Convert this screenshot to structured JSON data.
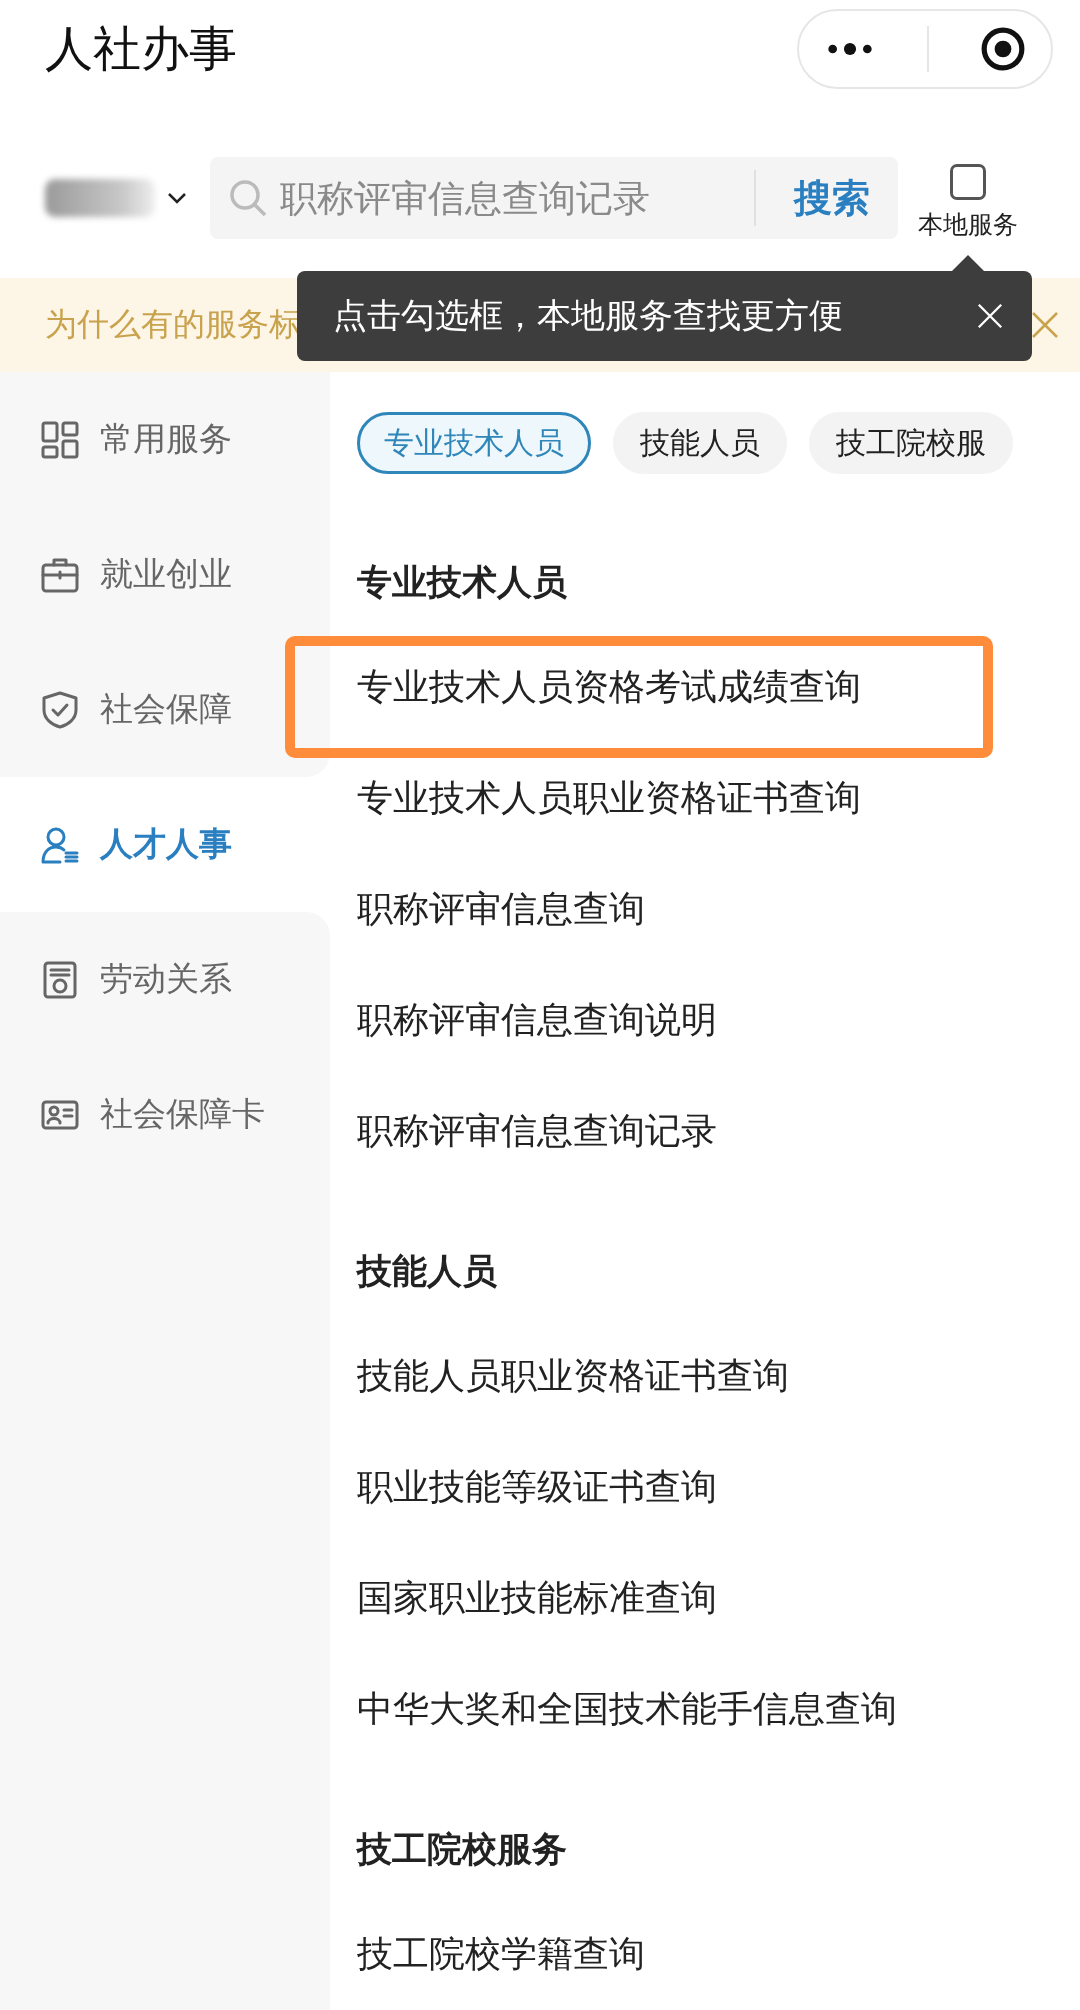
{
  "header": {
    "title": "人社办事"
  },
  "search": {
    "placeholder": "职称评审信息查询记录",
    "button": "搜索"
  },
  "local_service": {
    "label": "本地服务",
    "checked": false
  },
  "notice": {
    "text": "为什么有的服务标"
  },
  "tooltip": {
    "text": "点击勾选框，本地服务查找更方便"
  },
  "sidebar": {
    "items": [
      {
        "label": "常用服务",
        "selected": false
      },
      {
        "label": "就业创业",
        "selected": false
      },
      {
        "label": "社会保障",
        "selected": false
      },
      {
        "label": "人才人事",
        "selected": true
      },
      {
        "label": "劳动关系",
        "selected": false
      },
      {
        "label": "社会保障卡",
        "selected": false
      }
    ]
  },
  "chips": [
    {
      "label": "专业技术人员",
      "selected": true
    },
    {
      "label": "技能人员",
      "selected": false
    },
    {
      "label": "技工院校服",
      "selected": false
    }
  ],
  "sections": [
    {
      "title": "专业技术人员",
      "items": [
        {
          "label": "专业技术人员资格考试成绩查询",
          "highlighted": true
        },
        {
          "label": "专业技术人员职业资格证书查询",
          "highlighted": false
        },
        {
          "label": "职称评审信息查询",
          "highlighted": false
        },
        {
          "label": "职称评审信息查询说明",
          "highlighted": false
        },
        {
          "label": "职称评审信息查询记录",
          "highlighted": false
        }
      ]
    },
    {
      "title": "技能人员",
      "items": [
        {
          "label": "技能人员职业资格证书查询",
          "highlighted": false
        },
        {
          "label": "职业技能等级证书查询",
          "highlighted": false
        },
        {
          "label": "国家职业技能标准查询",
          "highlighted": false
        },
        {
          "label": "中华大奖和全国技术能手信息查询",
          "highlighted": false
        }
      ]
    },
    {
      "title": "技工院校服务",
      "items": [
        {
          "label": "技工院校学籍查询",
          "highlighted": false
        }
      ]
    }
  ]
}
